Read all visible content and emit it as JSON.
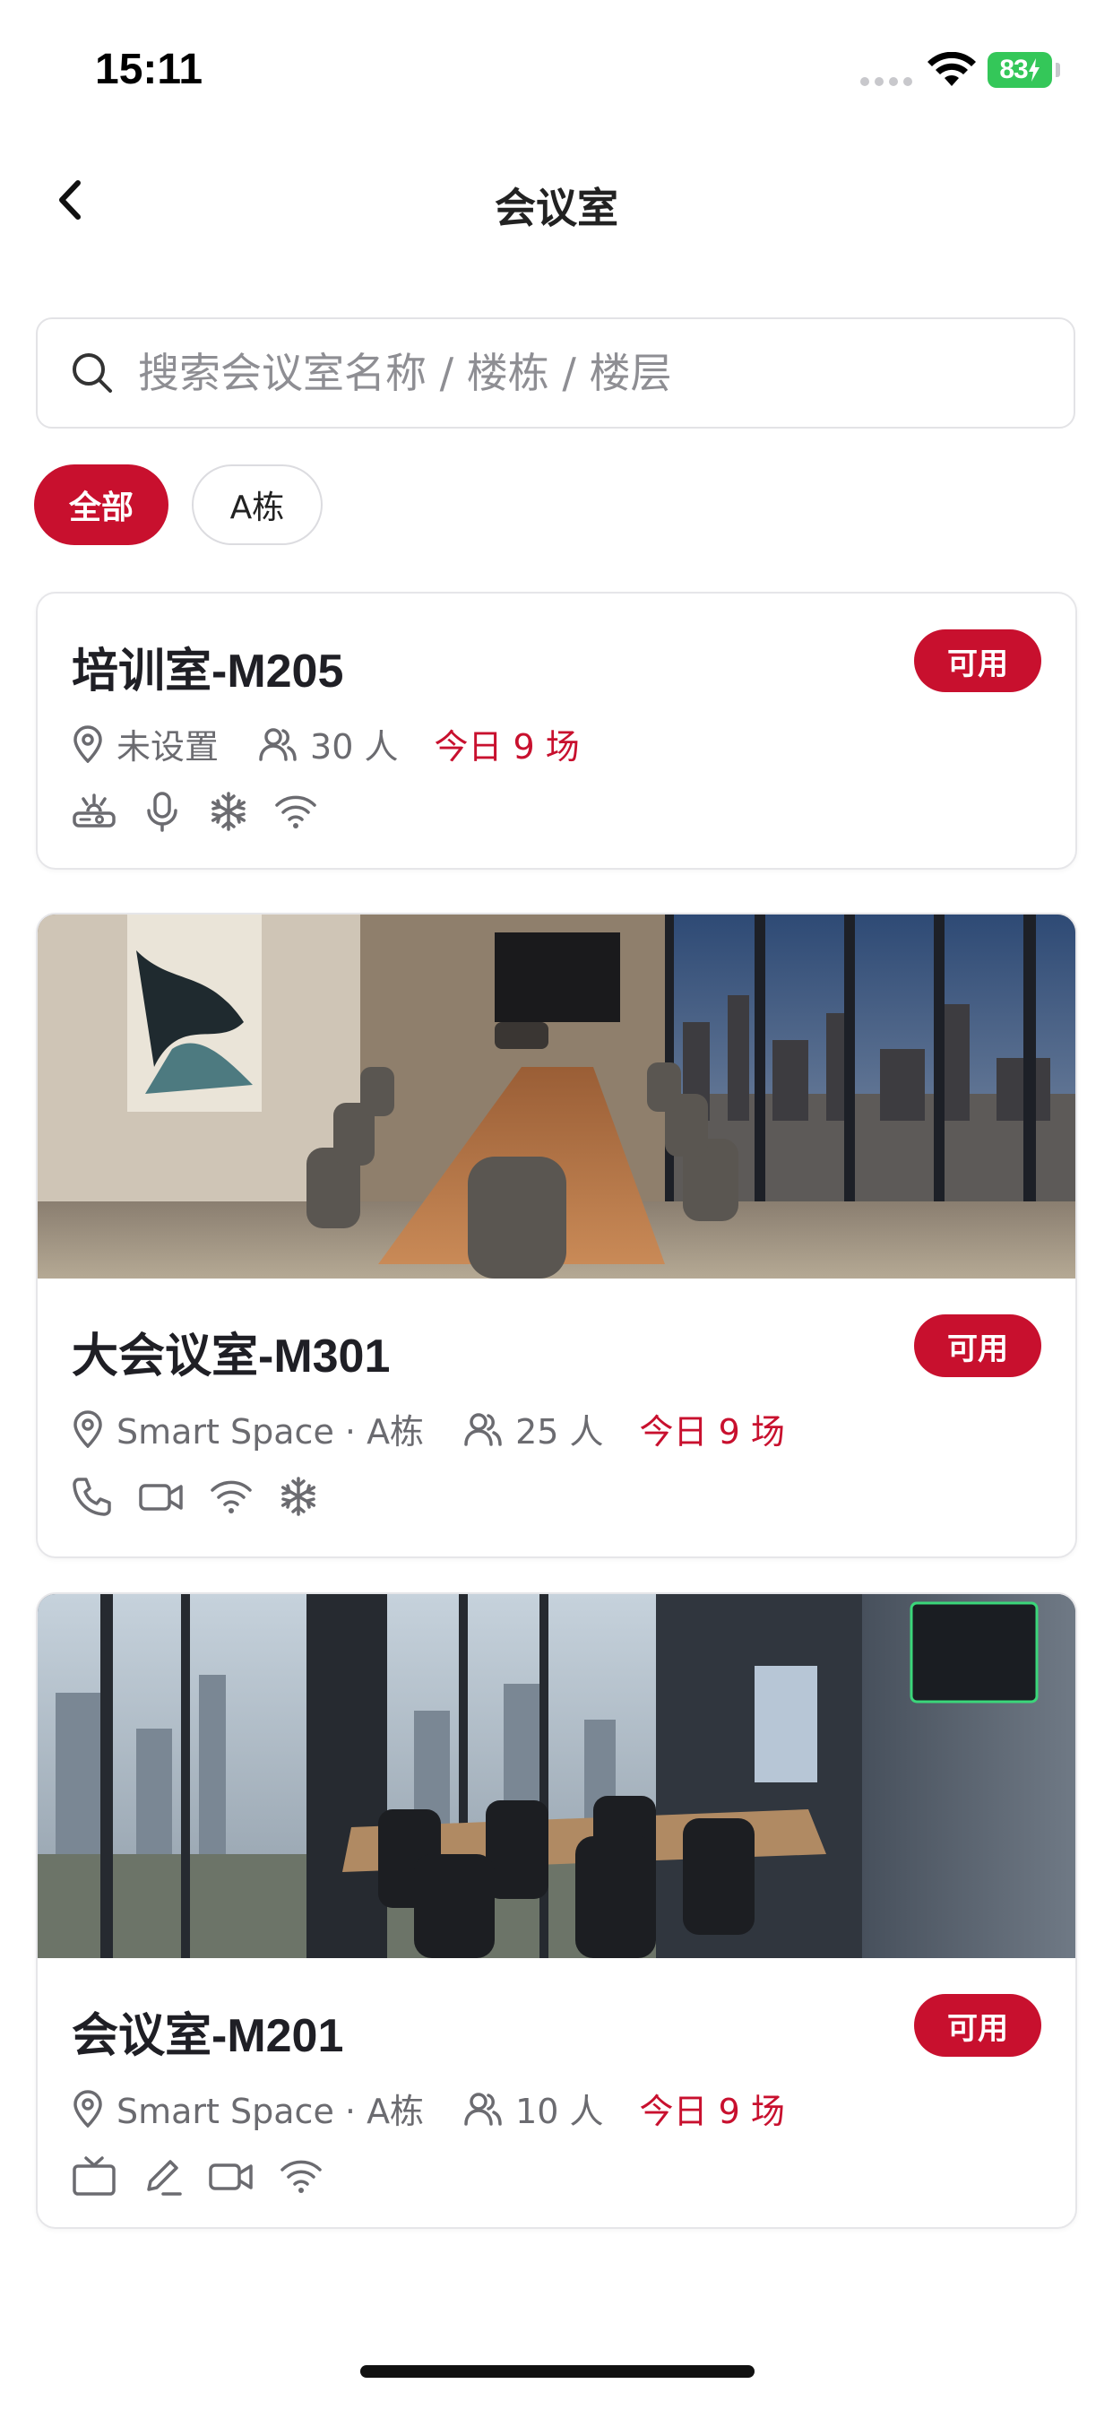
{
  "status_bar": {
    "time": "15:11",
    "battery": "83"
  },
  "nav": {
    "title": "会议室"
  },
  "search": {
    "placeholder": "搜索会议室名称 / 楼栋 / 楼层",
    "value": ""
  },
  "filters": [
    {
      "label": "全部",
      "active": true
    },
    {
      "label": "A栋",
      "active": false
    }
  ],
  "rooms": [
    {
      "name": "培训室-M205",
      "status": "可用",
      "location": "未设置",
      "capacity": "30 人",
      "today": "今日 9 场",
      "has_photo": false,
      "amenities": [
        "projector-icon",
        "microphone-icon",
        "air-conditioner-icon",
        "wifi-icon"
      ]
    },
    {
      "name": "大会议室-M301",
      "status": "可用",
      "location": "Smart Space · A栋",
      "capacity": "25 人",
      "today": "今日 9 场",
      "has_photo": true,
      "amenities": [
        "phone-icon",
        "video-camera-icon",
        "wifi-icon",
        "air-conditioner-icon"
      ]
    },
    {
      "name": "会议室-M201",
      "status": "可用",
      "location": "Smart Space · A栋",
      "capacity": "10 人",
      "today": "今日 9 场",
      "has_photo": true,
      "amenities": [
        "tv-icon",
        "whiteboard-pen-icon",
        "video-camera-icon",
        "wifi-icon"
      ]
    }
  ],
  "colors": {
    "accent": "#c8102e",
    "battery": "#34c759"
  }
}
